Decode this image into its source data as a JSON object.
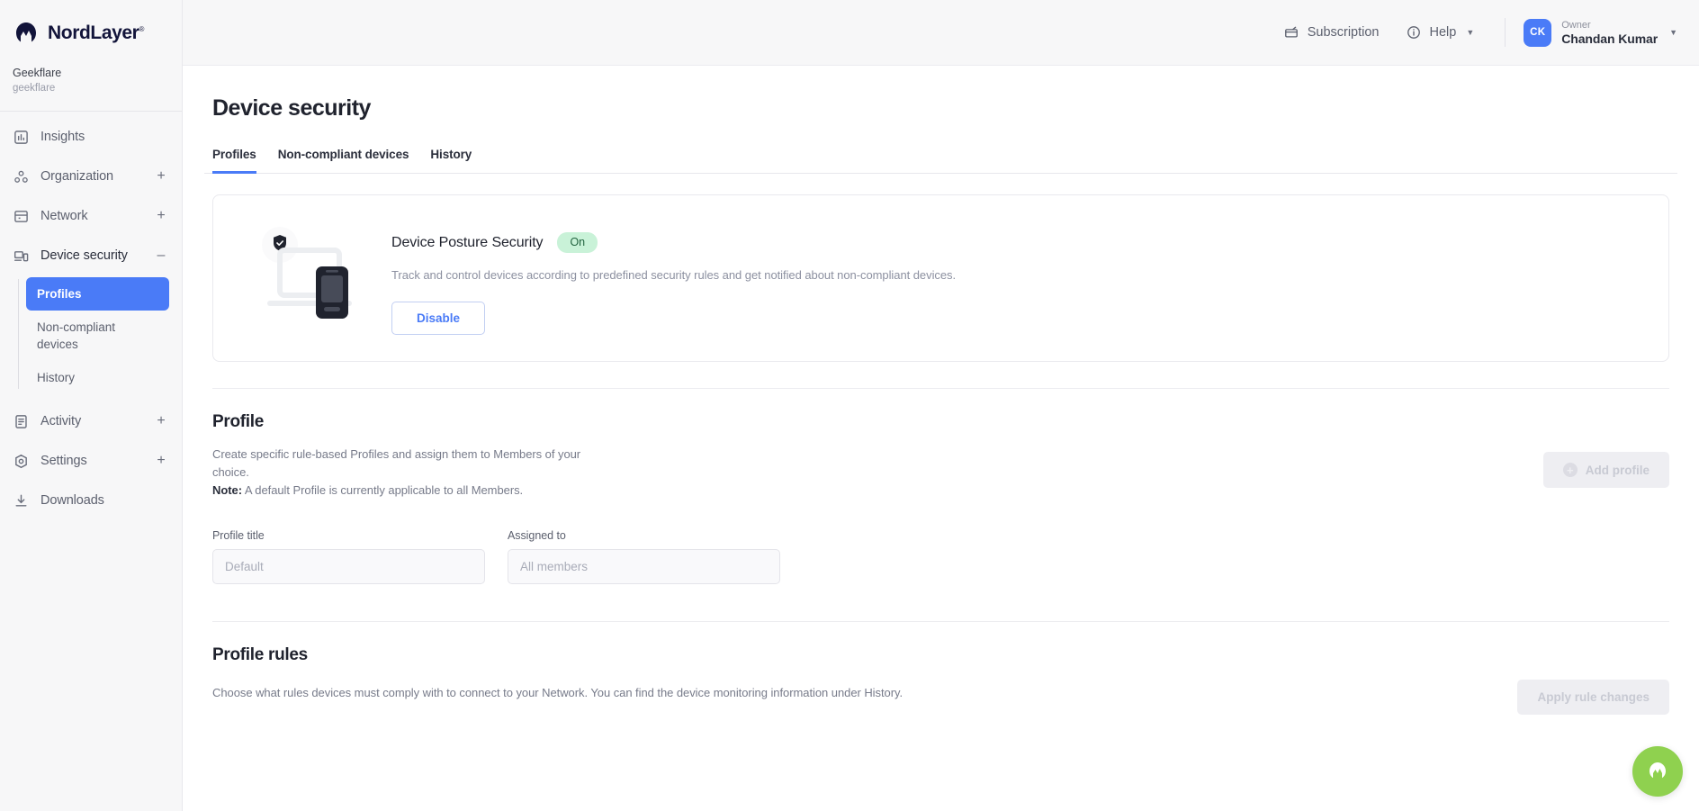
{
  "sidebar": {
    "brand": {
      "name": "NordLayer",
      "trademark": "®",
      "icon": "nordlayer-logo-icon"
    },
    "organization": {
      "name": "Geekflare",
      "slug": "geekflare"
    },
    "items": [
      {
        "label": "Insights",
        "icon": "insights-icon",
        "toggle": ""
      },
      {
        "label": "Organization",
        "icon": "organization-icon",
        "toggle": "+"
      },
      {
        "label": "Network",
        "icon": "network-icon",
        "toggle": "+"
      },
      {
        "label": "Device security",
        "icon": "device-security-icon",
        "toggle": "–"
      },
      {
        "label": "Activity",
        "icon": "activity-icon",
        "toggle": "+"
      },
      {
        "label": "Settings",
        "icon": "settings-icon",
        "toggle": "+"
      },
      {
        "label": "Downloads",
        "icon": "downloads-icon",
        "toggle": ""
      }
    ],
    "subitems": [
      {
        "label": "Profiles",
        "selected": true
      },
      {
        "label": "Non-compliant devices",
        "selected": false
      },
      {
        "label": "History",
        "selected": false
      }
    ]
  },
  "topbar": {
    "subscription_label": "Subscription",
    "subscription_icon": "subscription-icon",
    "help_label": "Help",
    "help_icon": "help-circle-icon",
    "caret_icon": "chevron-down-icon",
    "user": {
      "initials": "CK",
      "role": "Owner",
      "name": "Chandan Kumar"
    }
  },
  "page": {
    "title": "Device security",
    "tabs": [
      {
        "label": "Profiles",
        "active": true
      },
      {
        "label": "Non-compliant devices",
        "active": false
      },
      {
        "label": "History",
        "active": false
      }
    ]
  },
  "posture_card": {
    "illustration_icon": "laptop-phone-shield-icon",
    "title": "Device Posture Security",
    "status_badge": "On",
    "description": "Track and control devices according to predefined security rules and get notified about non-compliant devices.",
    "action_label": "Disable"
  },
  "profile_section": {
    "title": "Profile",
    "description_line1": "Create specific rule-based Profiles and assign them to Members of your",
    "description_line2": "choice.",
    "note_label": "Note:",
    "note_text": " A default Profile is currently applicable to all Members.",
    "add_button_label": "Add profile",
    "add_button_icon": "plus-circle-icon",
    "fields": [
      {
        "label": "Profile title",
        "value": "",
        "placeholder": "Default"
      },
      {
        "label": "Assigned to",
        "value": "",
        "placeholder": "All members"
      }
    ]
  },
  "rules_section": {
    "title": "Profile rules",
    "description": "Choose what rules devices must comply with to connect to your Network. You can find the device monitoring information under History.",
    "apply_button_label": "Apply rule changes"
  },
  "fab": {
    "icon": "nordlayer-widget-icon"
  },
  "colors": {
    "accent": "#4a7bf7",
    "badge_bg": "#c9f2d8",
    "badge_text": "#22633f",
    "fab": "#8fd14f",
    "sidebar_bg": "#f7f7f8"
  }
}
